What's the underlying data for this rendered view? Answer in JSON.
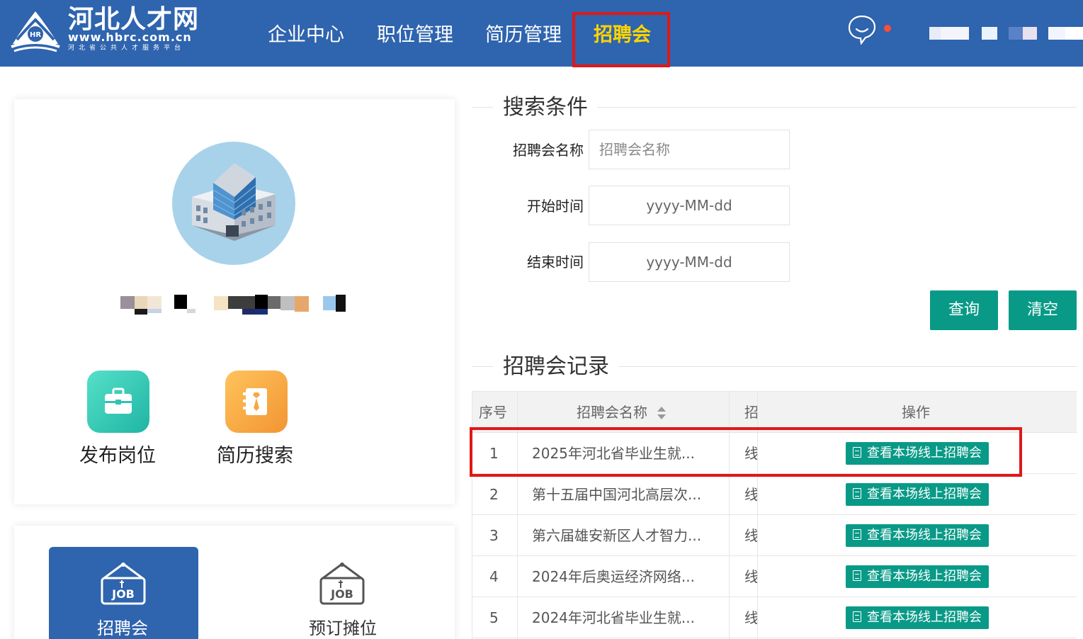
{
  "header": {
    "logo_title": "河北人才网",
    "logo_url": "www.hbrc.com.cn",
    "logo_subtitle": "河北省公共人才服务平台",
    "logo_badge": "HR",
    "nav": [
      "企业中心",
      "职位管理",
      "简历管理",
      "招聘会"
    ],
    "active_nav": "招聘会",
    "chat_icon": "chat-bubble-icon"
  },
  "left": {
    "avatar_icon": "office-building-icon",
    "quick_actions": [
      {
        "label": "发布岗位",
        "icon": "briefcase-icon"
      },
      {
        "label": "简历搜索",
        "icon": "resume-icon"
      }
    ],
    "bottom_tabs": [
      {
        "label": "招聘会",
        "icon": "job-sign-icon",
        "active": true
      },
      {
        "label": "预订摊位",
        "icon": "job-sign-icon",
        "active": false
      }
    ],
    "job_sign_text": "JOB"
  },
  "search": {
    "title": "搜索条件",
    "name_label": "招聘会名称",
    "name_placeholder": "招聘会名称",
    "start_label": "开始时间",
    "start_placeholder": "yyyy-MM-dd",
    "end_label": "结束时间",
    "end_placeholder": "yyyy-MM-dd",
    "query_button": "查询",
    "clear_button": "清空"
  },
  "records": {
    "title": "招聘会记录",
    "columns": [
      "序号",
      "招聘会名称",
      "招",
      "操作"
    ],
    "action_label": "查看本场线上招聘会",
    "rows": [
      {
        "index": "1",
        "name": "2025年河北省毕业生就...",
        "type": "线"
      },
      {
        "index": "2",
        "name": "第十五届中国河北高层次...",
        "type": "线"
      },
      {
        "index": "3",
        "name": "第六届雄安新区人才智力...",
        "type": "线"
      },
      {
        "index": "4",
        "name": "2024年后奥运经济网络...",
        "type": "线"
      },
      {
        "index": "5",
        "name": "2024年河北省毕业生就...",
        "type": "线"
      }
    ]
  },
  "colors": {
    "header_blue": "#2f64ae",
    "active_nav": "#ffd400",
    "button_teal": "#099a87",
    "highlight_red": "#e01818"
  }
}
